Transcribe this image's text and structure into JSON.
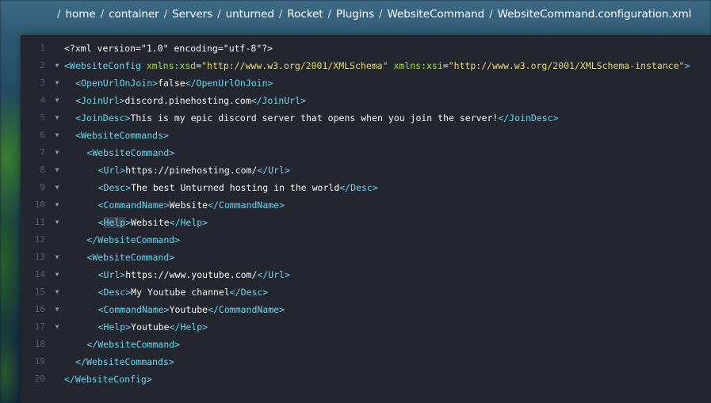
{
  "breadcrumb": {
    "items": [
      "home",
      "container",
      "Servers",
      "unturned",
      "Rocket",
      "Plugins",
      "WebsiteCommand",
      "WebsiteCommand.configuration.xml"
    ],
    "separator": "/"
  },
  "editor": {
    "colors": {
      "background": "#23252f",
      "tag": "#66d9ef",
      "attribute": "#a6e22e",
      "string": "#e6db74",
      "text": "#f8f8f2",
      "line_number": "#5a5f6e"
    },
    "fold_icon": "triangle-down-icon",
    "lines": [
      {
        "n": "1",
        "indent": 0,
        "fold": false,
        "tokens": [
          {
            "t": "pi",
            "v": "<?xml version=\"1.0\" encoding=\"utf-8\"?>"
          }
        ]
      },
      {
        "n": "2",
        "indent": 0,
        "fold": true,
        "tokens": [
          {
            "t": "tag",
            "v": "<WebsiteConfig"
          },
          {
            "t": "txt",
            "v": " "
          },
          {
            "t": "attr",
            "v": "xmlns:xsd"
          },
          {
            "t": "txt",
            "v": "="
          },
          {
            "t": "str",
            "v": "\"http://www.w3.org/2001/XMLSchema\""
          },
          {
            "t": "txt",
            "v": " "
          },
          {
            "t": "attr",
            "v": "xmlns:xsi"
          },
          {
            "t": "txt",
            "v": "="
          },
          {
            "t": "str",
            "v": "\"http://www.w3.org/2001/XMLSchema-instance\""
          },
          {
            "t": "tag",
            "v": ">"
          }
        ]
      },
      {
        "n": "3",
        "indent": 1,
        "fold": true,
        "tokens": [
          {
            "t": "tag",
            "v": "<OpenUrlOnJoin>"
          },
          {
            "t": "txt",
            "v": "false"
          },
          {
            "t": "tag",
            "v": "</OpenUrlOnJoin>"
          }
        ]
      },
      {
        "n": "4",
        "indent": 1,
        "fold": true,
        "tokens": [
          {
            "t": "tag",
            "v": "<JoinUrl>"
          },
          {
            "t": "txt",
            "v": "discord.pinehosting.com"
          },
          {
            "t": "tag",
            "v": "</JoinUrl>"
          }
        ]
      },
      {
        "n": "5",
        "indent": 1,
        "fold": true,
        "tokens": [
          {
            "t": "tag",
            "v": "<JoinDesc>"
          },
          {
            "t": "txt",
            "v": "This is my epic discord server that opens when you join the server!"
          },
          {
            "t": "tag",
            "v": "</JoinDesc>"
          }
        ]
      },
      {
        "n": "6",
        "indent": 1,
        "fold": true,
        "tokens": [
          {
            "t": "tag",
            "v": "<WebsiteCommands>"
          }
        ]
      },
      {
        "n": "7",
        "indent": 2,
        "fold": true,
        "tokens": [
          {
            "t": "tag",
            "v": "<WebsiteCommand>"
          }
        ]
      },
      {
        "n": "8",
        "indent": 3,
        "fold": true,
        "tokens": [
          {
            "t": "tag",
            "v": "<Url>"
          },
          {
            "t": "txt",
            "v": "https://pinehosting.com/"
          },
          {
            "t": "tag",
            "v": "</Url>"
          }
        ]
      },
      {
        "n": "9",
        "indent": 3,
        "fold": true,
        "tokens": [
          {
            "t": "tag",
            "v": "<Desc>"
          },
          {
            "t": "txt",
            "v": "The best Unturned hosting in the world"
          },
          {
            "t": "tag",
            "v": "</Desc>"
          }
        ]
      },
      {
        "n": "10",
        "indent": 3,
        "fold": true,
        "tokens": [
          {
            "t": "tag",
            "v": "<CommandName>"
          },
          {
            "t": "txt",
            "v": "Website"
          },
          {
            "t": "tag",
            "v": "</CommandName>"
          }
        ]
      },
      {
        "n": "11",
        "indent": 3,
        "fold": true,
        "tokens": [
          {
            "t": "tag",
            "v": "<"
          },
          {
            "t": "hl",
            "v": "Help"
          },
          {
            "t": "tag",
            "v": ">"
          },
          {
            "t": "txt",
            "v": "Website"
          },
          {
            "t": "tag",
            "v": "</Help>"
          }
        ]
      },
      {
        "n": "12",
        "indent": 2,
        "fold": false,
        "tokens": [
          {
            "t": "tag",
            "v": "</WebsiteCommand>"
          }
        ]
      },
      {
        "n": "13",
        "indent": 2,
        "fold": true,
        "tokens": [
          {
            "t": "tag",
            "v": "<WebsiteCommand>"
          }
        ]
      },
      {
        "n": "14",
        "indent": 3,
        "fold": true,
        "tokens": [
          {
            "t": "tag",
            "v": "<Url>"
          },
          {
            "t": "txt",
            "v": "https://www.youtube.com/"
          },
          {
            "t": "tag",
            "v": "</Url>"
          }
        ]
      },
      {
        "n": "15",
        "indent": 3,
        "fold": true,
        "tokens": [
          {
            "t": "tag",
            "v": "<Desc>"
          },
          {
            "t": "txt",
            "v": "My Youtube channel"
          },
          {
            "t": "tag",
            "v": "</Desc>"
          }
        ]
      },
      {
        "n": "16",
        "indent": 3,
        "fold": true,
        "tokens": [
          {
            "t": "tag",
            "v": "<CommandName>"
          },
          {
            "t": "txt",
            "v": "Youtube"
          },
          {
            "t": "tag",
            "v": "</CommandName>"
          }
        ]
      },
      {
        "n": "17",
        "indent": 3,
        "fold": true,
        "tokens": [
          {
            "t": "tag",
            "v": "<Help>"
          },
          {
            "t": "txt",
            "v": "Youtube"
          },
          {
            "t": "tag",
            "v": "</Help>"
          }
        ]
      },
      {
        "n": "18",
        "indent": 2,
        "fold": false,
        "tokens": [
          {
            "t": "tag",
            "v": "</WebsiteCommand>"
          }
        ]
      },
      {
        "n": "19",
        "indent": 1,
        "fold": false,
        "tokens": [
          {
            "t": "tag",
            "v": "</WebsiteCommands>"
          }
        ]
      },
      {
        "n": "20",
        "indent": 0,
        "fold": false,
        "tokens": [
          {
            "t": "tag",
            "v": "</WebsiteConfig>"
          }
        ]
      }
    ]
  }
}
